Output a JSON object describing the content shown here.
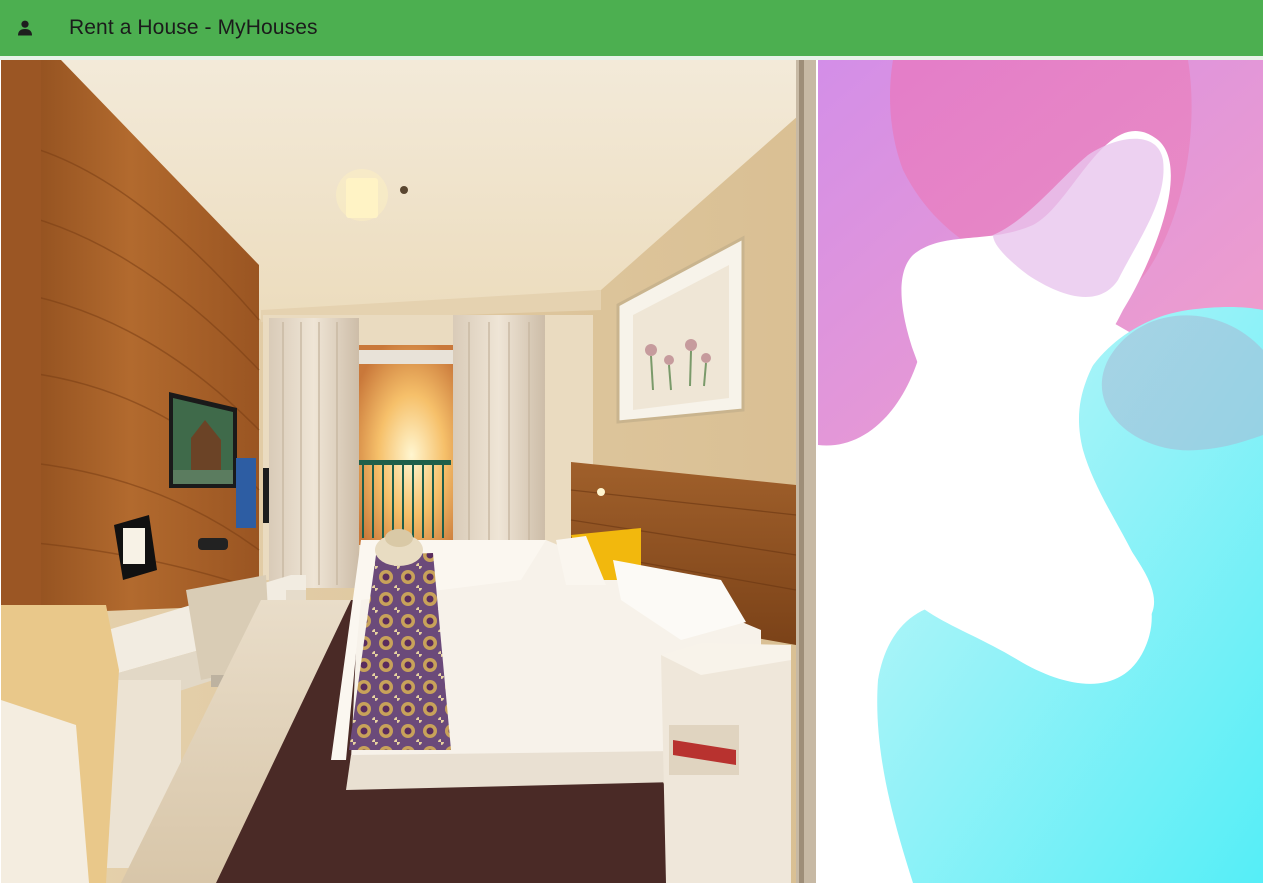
{
  "header": {
    "title": "Rent a House - MyHouses",
    "icon": "user-icon",
    "background_color": "#4caf50"
  }
}
